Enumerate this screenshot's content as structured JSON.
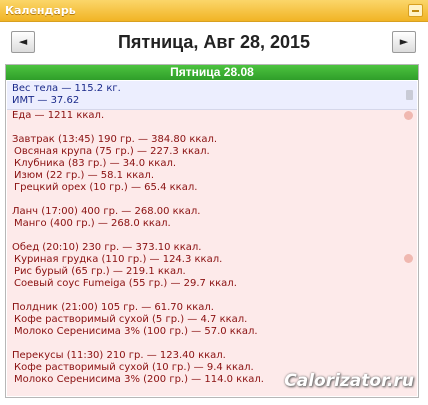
{
  "window": {
    "title": "Календарь"
  },
  "nav": {
    "prev_label": "◄",
    "next_label": "►",
    "date_heading": "Пятница, Авг 28, 2015"
  },
  "day": {
    "header": "Пятница 28.08",
    "weight_line": "Вес тела — 115.2 кг.",
    "bmi_line": "ИМТ — 37.62",
    "food_total": "Еда — 1211 ккал.",
    "meals": [
      {
        "header": "Завтрак (13:45) 190 гр. — 384.80 ккал.",
        "items": [
          "Овсяная крупа (75 гр.) — 227.3 ккал.",
          "Клубника (83 гр.) — 34.0 ккал.",
          "Изюм (22 гр.) — 58.1 ккал.",
          "Грецкий орех (10 гр.) — 65.4 ккал."
        ]
      },
      {
        "header": "Ланч (17:00) 400 гр. — 268.00 ккал.",
        "items": [
          "Манго (400 гр.) — 268.0 ккал."
        ]
      },
      {
        "header": "Обед (20:10) 230 гр. — 373.10 ккал.",
        "items": [
          "Куриная грудка (110 гр.) — 124.3 ккал.",
          "Рис бурый (65 гр.) — 219.1 ккал.",
          "Соевый соус Fumeiga (55 гр.) — 29.7 ккал."
        ]
      },
      {
        "header": "Полдник (21:00) 105 гр. — 61.70 ккал.",
        "items": [
          "Кофе растворимый сухой (5 гр.) — 4.7 ккал.",
          "Молоко Серенисима 3% (100 гр.) — 57.0 ккал."
        ]
      },
      {
        "header": "Перекусы (11:30) 210 гр. — 123.40 ккал.",
        "items": [
          "Кофе растворимый сухой (10 гр.) — 9.4 ккал.",
          "Молоко Серенисима 3% (200 гр.) — 114.0 ккал."
        ]
      }
    ]
  },
  "watermark": "Calorizator.ru"
}
